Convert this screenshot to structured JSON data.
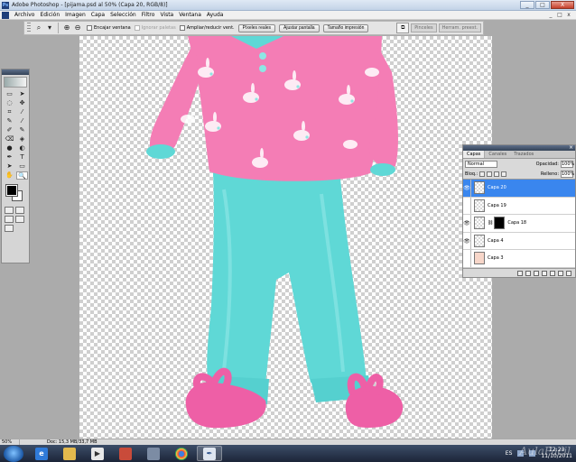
{
  "window": {
    "title": "Adobe Photoshop - [pijama.psd al 50% (Capa 20, RGB/8)]",
    "buttons": [
      "_",
      "□",
      "X"
    ]
  },
  "menubar": {
    "items": [
      "Archivo",
      "Edición",
      "Imagen",
      "Capa",
      "Selección",
      "Filtro",
      "Vista",
      "Ventana",
      "Ayuda"
    ],
    "doc_controls": [
      "_",
      "□",
      "x"
    ]
  },
  "options": {
    "checks": [
      {
        "label": "Encajar ventana",
        "disabled": false
      },
      {
        "label": "Ignorar paletas",
        "disabled": true
      },
      {
        "label": "Ampliar/reducir vent.",
        "disabled": false
      }
    ],
    "buttons": [
      "Píxeles reales",
      "Ajustar pantalla",
      "Tamaño impresión"
    ],
    "well_tabs": [
      "Pinceles",
      "Herram. preest."
    ]
  },
  "tools": [
    [
      "▭",
      "➤"
    ],
    [
      "◌",
      "✥"
    ],
    [
      "⌗",
      "⁄"
    ],
    [
      "✎",
      "⁄"
    ],
    [
      "✐",
      "✎"
    ],
    [
      "⌫",
      "◈"
    ],
    [
      "●",
      "◐"
    ],
    [
      "✒",
      "T"
    ],
    [
      "➤",
      "▭"
    ],
    [
      "✋",
      "🔍"
    ]
  ],
  "layers_panel": {
    "tabs": [
      "Capas",
      "Canales",
      "Trazados"
    ],
    "blend_mode": "Normal",
    "opacity_label": "Opacidad:",
    "opacity": "100%",
    "lock_label": "Bloq.:",
    "fill_label": "Relleno:",
    "fill": "100%",
    "layers": [
      {
        "name": "Capa 20",
        "visible": true,
        "selected": true,
        "mask": false,
        "thumb": "transparent"
      },
      {
        "name": "Capa 19",
        "visible": false,
        "selected": false,
        "mask": false,
        "thumb": "transparent"
      },
      {
        "name": "Capa 18",
        "visible": true,
        "selected": false,
        "mask": true,
        "thumb": "transparent"
      },
      {
        "name": "Capa 4",
        "visible": true,
        "selected": false,
        "mask": false,
        "thumb": "transparent"
      },
      {
        "name": "Capa 3",
        "visible": false,
        "selected": false,
        "mask": false,
        "thumb": "pose"
      }
    ]
  },
  "status": {
    "zoom": "50%",
    "doc": "Doc: 15,3 MB/33,7 MB"
  },
  "taskbar": {
    "language": "ES",
    "time": "12:23",
    "date": "11/10/2011"
  },
  "watermark": "AulaFacil"
}
